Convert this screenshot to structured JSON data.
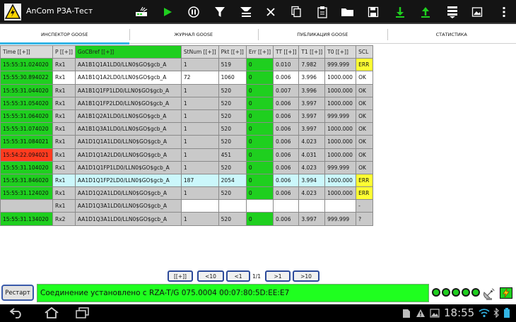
{
  "app": {
    "title": "AnCom РЗА-Тест"
  },
  "toolbar": {
    "icons": [
      "network-icon",
      "play-icon",
      "pause-icon",
      "filter-icon",
      "clear-filter-icon",
      "close-icon",
      "copy-icon",
      "paste-icon",
      "open-folder-icon",
      "save-icon",
      "download-icon",
      "upload-icon",
      "list-icon",
      "image-icon",
      "overflow-menu-icon"
    ]
  },
  "tabs": [
    {
      "label": "ИНСПЕКТОР GOOSE",
      "active": true
    },
    {
      "label": "ЖУРНАЛ GOOSE",
      "active": false
    },
    {
      "label": "ПУБЛИКАЦИЯ GOOSE",
      "active": false
    },
    {
      "label": "СТАТИСТИКА",
      "active": false
    }
  ],
  "table": {
    "headers": {
      "time": "Time [[+]]",
      "p": "P [[+]]",
      "gocbref": "GoCBref [[+]]",
      "stnum": "StNum [[+]]",
      "pkt": "Pkt [[+]]",
      "err": "Err [[+]]",
      "tt": "TT [[+]]",
      "t1": "T1 [[+]]",
      "t0": "T0 [[+]]",
      "scl": "SCL"
    },
    "rows": [
      {
        "time": "15:55:31.024020",
        "p": "Rx1",
        "gocbref": "AA1B1Q1A1LD0/LLN0$GO$gcb_A",
        "stnum": "1",
        "pkt": "519",
        "err": "0",
        "tt": "0.010",
        "t1": "7.982",
        "t0": "999.999",
        "scl": "ERR"
      },
      {
        "time": "15:55:30.894022",
        "p": "Rx1",
        "gocbref": "AA1B1Q1A2LD0/LLN0$GO$gcb_A",
        "stnum": "72",
        "pkt": "1060",
        "err": "0",
        "tt": "0.006",
        "t1": "3.996",
        "t0": "1000.000",
        "scl": "OK"
      },
      {
        "time": "15:55:31.044020",
        "p": "Rx1",
        "gocbref": "AA1B1Q1FP1LD0/LLN0$GO$gcb_A",
        "stnum": "1",
        "pkt": "520",
        "err": "0",
        "tt": "0.007",
        "t1": "3.996",
        "t0": "1000.000",
        "scl": "OK"
      },
      {
        "time": "15:55:31.054020",
        "p": "Rx1",
        "gocbref": "AA1B1Q1FP2LD0/LLN0$GO$gcb_A",
        "stnum": "1",
        "pkt": "520",
        "err": "0",
        "tt": "0.006",
        "t1": "3.997",
        "t0": "1000.000",
        "scl": "OK"
      },
      {
        "time": "15:55:31.064020",
        "p": "Rx1",
        "gocbref": "AA1B1Q2A1LD0/LLN0$GO$gcb_A",
        "stnum": "1",
        "pkt": "520",
        "err": "0",
        "tt": "0.006",
        "t1": "3.997",
        "t0": "999.999",
        "scl": "OK"
      },
      {
        "time": "15:55:31.074020",
        "p": "Rx1",
        "gocbref": "AA1B1Q3A1LD0/LLN0$GO$gcb_A",
        "stnum": "1",
        "pkt": "520",
        "err": "0",
        "tt": "0.006",
        "t1": "3.997",
        "t0": "1000.000",
        "scl": "OK"
      },
      {
        "time": "15:55:31.084021",
        "p": "Rx1",
        "gocbref": "AA1D1Q1A1LD0/LLN0$GO$gcb_A",
        "stnum": "1",
        "pkt": "520",
        "err": "0",
        "tt": "0.006",
        "t1": "4.023",
        "t0": "1000.000",
        "scl": "OK"
      },
      {
        "time": "15:54:22.094021",
        "p": "Rx1",
        "gocbref": "AA1D1Q1A2LD0/LLN0$GO$gcb_A",
        "stnum": "1",
        "pkt": "451",
        "err": "0",
        "tt": "0.006",
        "t1": "4.031",
        "t0": "1000.000",
        "scl": "OK"
      },
      {
        "time": "15:55:31.104020",
        "p": "Rx1",
        "gocbref": "AA1D1Q1FP1LD0/LLN0$GO$gcb_A",
        "stnum": "1",
        "pkt": "520",
        "err": "0",
        "tt": "0.006",
        "t1": "4.023",
        "t0": "999.999",
        "scl": "OK"
      },
      {
        "time": "15:55:31.846020",
        "p": "Rx1",
        "gocbref": "AA1D1Q1FP2LD0/LLN0$GO$gcb_A",
        "stnum": "187",
        "pkt": "2054",
        "err": "0",
        "tt": "0.006",
        "t1": "3.994",
        "t0": "1000.000",
        "scl": "ERR"
      },
      {
        "time": "15:55:31.124020",
        "p": "Rx1",
        "gocbref": "AA1D1Q2A1LD0/LLN0$GO$gcb_A",
        "stnum": "1",
        "pkt": "520",
        "err": "0",
        "tt": "0.006",
        "t1": "4.023",
        "t0": "1000.000",
        "scl": "ERR"
      },
      {
        "time": "",
        "p": "Rx1",
        "gocbref": "AA1D1Q3A1LD0/LLN0$GO$gcb_A",
        "stnum": "",
        "pkt": "",
        "err": "",
        "tt": "",
        "t1": "",
        "t0": "",
        "scl": "-"
      },
      {
        "time": "15:55:31.134020",
        "p": "Rx2",
        "gocbref": "AA1D1Q3A1LD0/LLN0$GO$gcb_A",
        "stnum": "1",
        "pkt": "520",
        "err": "0",
        "tt": "0.006",
        "t1": "3.997",
        "t0": "999.999",
        "scl": "?"
      }
    ]
  },
  "pager": {
    "expand_label": "[[+]]",
    "prev10_label": "<10",
    "prev_label": "<1",
    "page_text": "1/1",
    "next_label": ">1",
    "next10_label": ">10"
  },
  "status": {
    "restart_label": "Рестарт",
    "message": "Соединение установлено с RZA-T/G 075.0004  00:07:80:5D:EE:E7",
    "indicator_color": "#1fcf1f"
  },
  "system": {
    "clock": "18:55"
  }
}
